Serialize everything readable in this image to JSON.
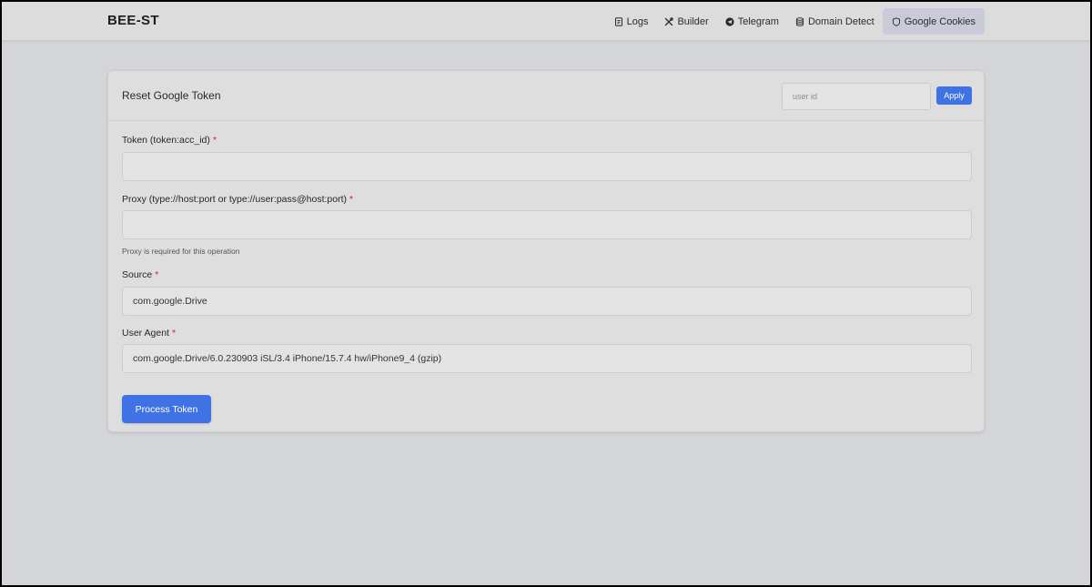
{
  "brand": "BEE-ST",
  "nav": {
    "items": [
      {
        "label": "Logs",
        "icon": "file-text-icon"
      },
      {
        "label": "Builder",
        "icon": "tools-icon"
      },
      {
        "label": "Telegram",
        "icon": "telegram-icon"
      },
      {
        "label": "Domain Detect",
        "icon": "database-icon"
      },
      {
        "label": "Google Cookies",
        "icon": "shield-icon",
        "active": true
      }
    ]
  },
  "card": {
    "title": "Reset Google Token",
    "user_id_placeholder": "user id",
    "apply_label": "Apply"
  },
  "form": {
    "token": {
      "label": "Token (token:acc_id)",
      "required": "*",
      "value": ""
    },
    "proxy": {
      "label": "Proxy (type://host:port or type://user:pass@host:port)",
      "required": "*",
      "value": "",
      "hint": "Proxy is required for this operation"
    },
    "source": {
      "label": "Source",
      "required": "*",
      "value": "com.google.Drive"
    },
    "user_agent": {
      "label": "User Agent",
      "required": "*",
      "value": "com.google.Drive/6.0.230903 iSL/3.4 iPhone/15.7.4 hw/iPhone9_4 (gzip)"
    },
    "submit_label": "Process Token"
  },
  "colors": {
    "accent": "#3f72e4",
    "required": "#d61f1f",
    "background": "#d4d5d9",
    "active_nav": "#c9ccd8"
  }
}
